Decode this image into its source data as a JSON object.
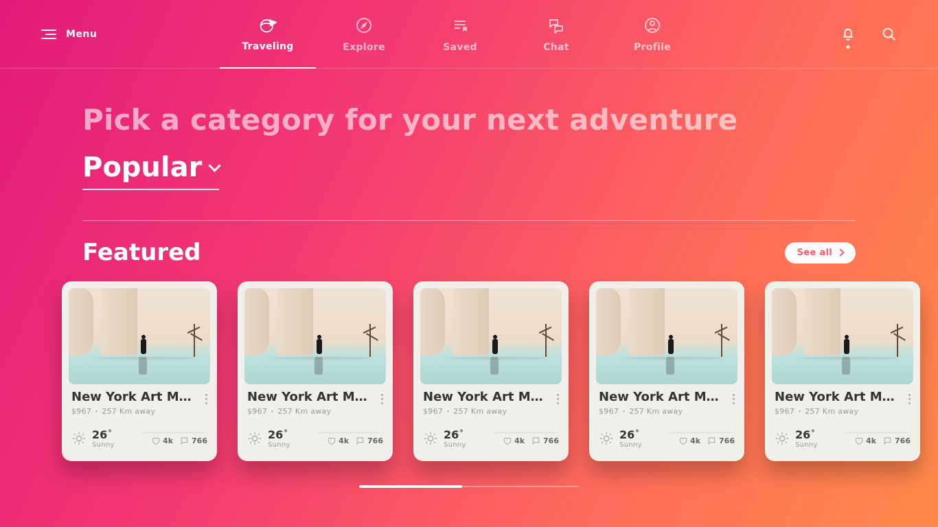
{
  "header": {
    "menu_label": "Menu",
    "tabs": [
      {
        "label": "Traveling",
        "icon": "globe-plane",
        "active": true
      },
      {
        "label": "Explore",
        "icon": "compass",
        "active": false
      },
      {
        "label": "Saved",
        "icon": "bookmark-list",
        "active": false
      },
      {
        "label": "Chat",
        "icon": "chat-bubbles",
        "active": false
      },
      {
        "label": "Profile",
        "icon": "user-circle",
        "active": false
      }
    ]
  },
  "page": {
    "headline": "Pick a category for your next adventure",
    "category_selected": "Popular"
  },
  "featured": {
    "section_title": "Featured",
    "see_all_label": "See all",
    "cards": [
      {
        "title": "New York Art Me…",
        "price": "$967",
        "distance": "257 Km away",
        "temp": "26",
        "condition": "Sunny",
        "likes": "4k",
        "comments": "766"
      },
      {
        "title": "New York Art Me…",
        "price": "$967",
        "distance": "257 Km away",
        "temp": "26",
        "condition": "Sunny",
        "likes": "4k",
        "comments": "766"
      },
      {
        "title": "New York Art Me…",
        "price": "$967",
        "distance": "257 Km away",
        "temp": "26",
        "condition": "Sunny",
        "likes": "4k",
        "comments": "766"
      },
      {
        "title": "New York Art Me…",
        "price": "$967",
        "distance": "257 Km away",
        "temp": "26",
        "condition": "Sunny",
        "likes": "4k",
        "comments": "766"
      },
      {
        "title": "New York Art Me…",
        "price": "$967",
        "distance": "257 Km away",
        "temp": "26",
        "condition": "Sunny",
        "likes": "4k",
        "comments": "766"
      }
    ]
  }
}
